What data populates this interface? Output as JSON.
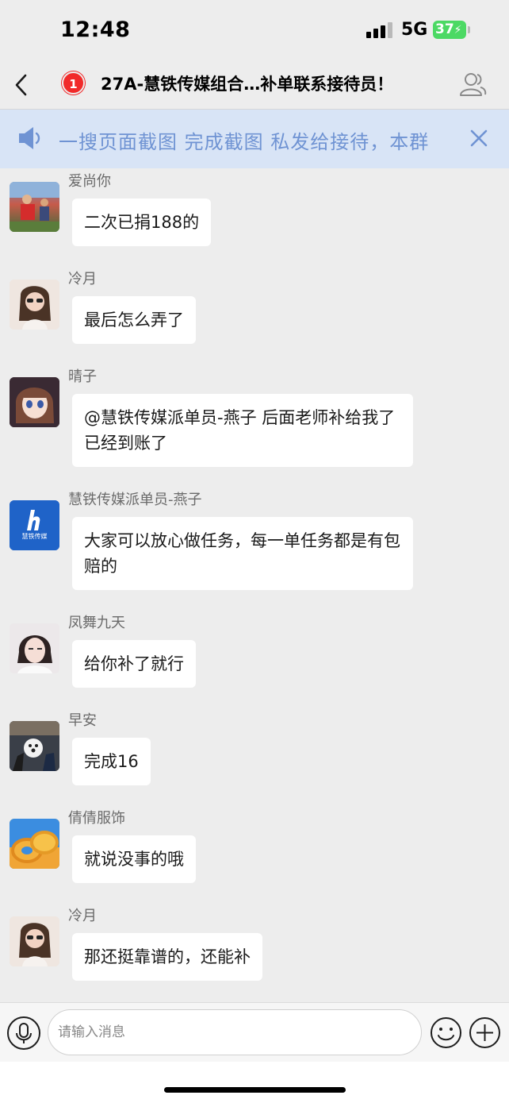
{
  "status_bar": {
    "time": "12:48",
    "network": "5G",
    "battery": "37"
  },
  "header": {
    "unread_count": "1",
    "title": "27A-慧铁传媒组合…补单联系接待员！"
  },
  "notice": {
    "text": "一搜页面截图  完成截图  私发给接待，本群"
  },
  "messages": [
    {
      "sender": "爱尚你",
      "text": "二次已捐188的"
    },
    {
      "sender": "冷月",
      "text": "最后怎么弄了"
    },
    {
      "sender": "晴子",
      "text": "@慧铁传媒派单员-燕子 后面老师补给我了已经到账了"
    },
    {
      "sender": "慧铁传媒派单员-燕子",
      "text": "大家可以放心做任务，每一单任务都是有包赔的",
      "avatar_text": "慧铁传媒"
    },
    {
      "sender": "凤舞九天",
      "text": "给你补了就行"
    },
    {
      "sender": "早安",
      "text": "完成16"
    },
    {
      "sender": "倩倩服饰",
      "text": "就说没事的哦"
    },
    {
      "sender": "冷月",
      "text": "那还挺靠谱的，还能补"
    }
  ],
  "input": {
    "placeholder": "请输入消息"
  },
  "colors": {
    "background": "#ededed",
    "notice_bg": "#d8e4f6",
    "notice_text": "#6f93d3",
    "badge": "#f12a2a",
    "battery": "#4cd964"
  },
  "icons": [
    "back-icon",
    "members-icon",
    "speaker-icon",
    "close-icon",
    "microphone-icon",
    "emoji-icon",
    "plus-icon"
  ]
}
